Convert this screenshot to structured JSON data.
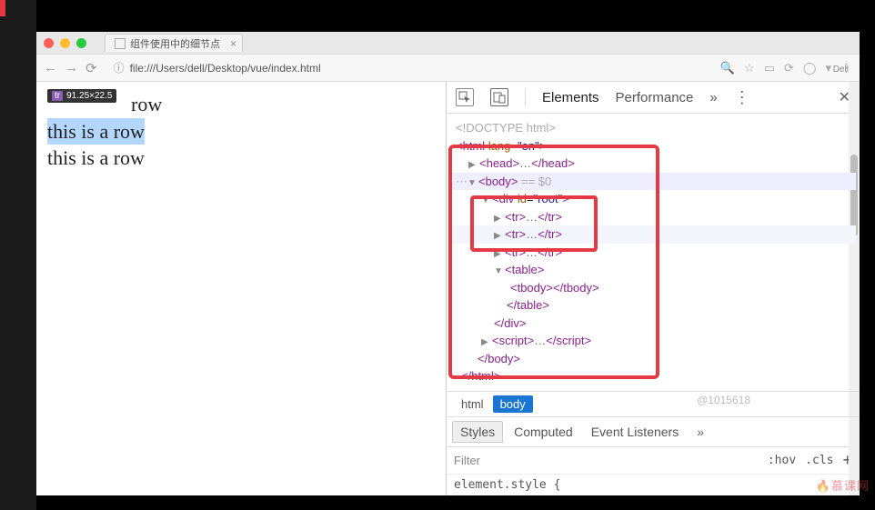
{
  "sidebar": {},
  "window": {
    "dell_label": "Dell"
  },
  "tab": {
    "title": "组件使用中的细节点"
  },
  "addressbar": {
    "url": "file:///Users/dell/Desktop/vue/index.html"
  },
  "inspect_tooltip": {
    "tag": "tr",
    "dims": "91.25×22.5"
  },
  "page_content": {
    "line1_suffix": "row",
    "line2": "this is a row",
    "line3": "this is a row"
  },
  "devtools": {
    "tabs": {
      "elements": "Elements",
      "performance": "Performance",
      "more": "»"
    },
    "dom": {
      "doctype": "<!DOCTYPE html>",
      "html_open": "<html lang=\"en\">",
      "head": "<head>…</head>",
      "body_open": "<body>",
      "body_mark": " == $0",
      "div_open": "<div id=\"root\">",
      "tr1": "<tr>…</tr>",
      "tr2": "<tr>…</tr>",
      "tr3": "<tr>…</tr>",
      "table_open": "<table>",
      "tbody": "<tbody></tbody>",
      "table_close": "</table>",
      "div_close": "</div>",
      "script": "<script>…</​script>",
      "body_close": "</body>",
      "html_close": "</html>"
    },
    "breadcrumb": {
      "html": "html",
      "body": "body"
    },
    "styles_tabs": {
      "styles": "Styles",
      "computed": "Computed",
      "events": "Event Listeners",
      "more": "»"
    },
    "filter": {
      "label": "Filter",
      "hov": ":hov",
      "cls": ".cls"
    },
    "style_body": "element.style {"
  },
  "watermarks": {
    "id": "@1015618",
    "brand": "🔥慕课网"
  }
}
